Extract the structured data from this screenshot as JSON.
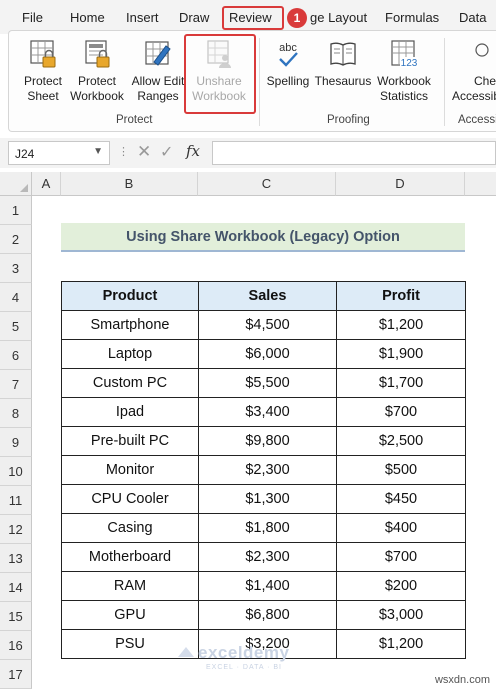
{
  "menu": {
    "tabs": [
      "File",
      "Home",
      "Insert",
      "Draw",
      "Review",
      "ge Layout",
      "Formulas",
      "Data"
    ],
    "active": "Review",
    "step_badge": "1"
  },
  "ribbon": {
    "protect_group": {
      "label": "Protect",
      "buttons": [
        {
          "line1": "Protect",
          "line2": "Sheet"
        },
        {
          "line1": "Protect",
          "line2": "Workbook"
        },
        {
          "line1": "Allow Edit",
          "line2": "Ranges"
        },
        {
          "line1": "Unshare",
          "line2": "Workbook"
        }
      ]
    },
    "proofing_group": {
      "label": "Proofing",
      "buttons": [
        {
          "line1": "Spelling",
          "line2": "",
          "icon_text": "abc"
        },
        {
          "line1": "Thesaurus",
          "line2": ""
        },
        {
          "line1": "Workbook",
          "line2": "Statistics",
          "icon_text": "123"
        }
      ]
    },
    "accessibility_group": {
      "label": "Accessi",
      "button_line1": "Che",
      "button_line2": "Accessib"
    }
  },
  "formula_bar": {
    "name_box": "J24",
    "fx": "fx",
    "value": ""
  },
  "grid": {
    "columns": [
      "A",
      "B",
      "C",
      "D"
    ],
    "rows": [
      "1",
      "2",
      "3",
      "4",
      "5",
      "6",
      "7",
      "8",
      "9",
      "10",
      "11",
      "12",
      "13",
      "14",
      "15",
      "16",
      "17"
    ]
  },
  "sheet": {
    "title": "Using Share Workbook (Legacy) Option",
    "headers": [
      "Product",
      "Sales",
      "Profit"
    ],
    "rows": [
      [
        "Smartphone",
        "$4,500",
        "$1,200"
      ],
      [
        "Laptop",
        "$6,000",
        "$1,900"
      ],
      [
        "Custom PC",
        "$5,500",
        "$1,700"
      ],
      [
        "Ipad",
        "$3,400",
        "$700"
      ],
      [
        "Pre-built PC",
        "$9,800",
        "$2,500"
      ],
      [
        "Monitor",
        "$2,300",
        "$500"
      ],
      [
        "CPU Cooler",
        "$1,300",
        "$450"
      ],
      [
        "Casing",
        "$1,800",
        "$400"
      ],
      [
        "Motherboard",
        "$2,300",
        "$700"
      ],
      [
        "RAM",
        "$1,400",
        "$200"
      ],
      [
        "GPU",
        "$6,800",
        "$3,000"
      ],
      [
        "PSU",
        "$3,200",
        "$1,200"
      ]
    ]
  },
  "watermark": {
    "name": "exceldemy",
    "tagline": "EXCEL · DATA · BI"
  },
  "site": "wsxdn.com",
  "colors": {
    "highlight": "#d93a3a",
    "title_fill": "#e2efda",
    "header_fill": "#ddebf7",
    "title_text": "#44546a"
  }
}
